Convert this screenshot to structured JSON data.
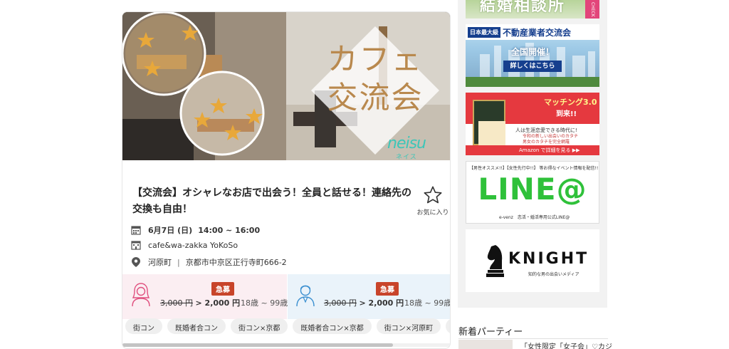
{
  "event": {
    "hero_title": "カフェ交流会",
    "logo_text": "neisu",
    "logo_sub": "ネイス",
    "title": "【交流会】オシャレなお店で出会う！全員と話せる！連絡先の交換も自由！",
    "favorite_label": "お気に入り",
    "date": "6月7日 (日)",
    "time": "14:00 ~ 16:00",
    "venue": "cafe&wa-zakka YoKoSo",
    "area": "河原町",
    "address": "京都市中京区正行寺町666-2",
    "female": {
      "badge": "急募",
      "old_price": "3,000 円",
      "new_price": "> 2,000 円",
      "age": "18歳 ~ 99歳"
    },
    "male": {
      "badge": "急募",
      "old_price": "3,000 円",
      "new_price": "> 2,000 円",
      "age": "18歳 ~ 99歳"
    },
    "tags": [
      "街コン",
      "既婚者合コン",
      "街コン×京都",
      "既婚者合コン×京都",
      "街コン×河原町",
      "既"
    ]
  },
  "sidebar": {
    "banners": {
      "b1": {
        "title": "結婚相談所",
        "check": "CHECK"
      },
      "b2": {
        "tag": "日本最大級",
        "title": "不動産業者交流会",
        "sub": "全国開催！",
        "button": "詳しくはこちら"
      },
      "b3": {
        "head": "マッチング3.0",
        "head2": "到来!!",
        "line1": "人は生涯恋愛できる時代に!",
        "line2": "令和の新しい出会いのカタチ",
        "line3": "男女のカタチを完全網羅",
        "amazon": "Amazon で詳細を見る ▶▶"
      },
      "b4": {
        "top": "【男性オススメ!!】【女性先行中!!】 等お得なイベント情報を配信!!",
        "logo": "LINE@",
        "bottom": "e-venz　恋活・婚活専用公式LINE@"
      },
      "b5": {
        "logo": "KNIGHT",
        "sub": "知的な男の出会いメディア"
      }
    },
    "section_title": "新着パーティー",
    "news_title": "「女性限定「女子会」♡カジ"
  },
  "colors": {
    "badge": "#c8442a",
    "line_green": "#2fc13a",
    "female_bg": "#fbeef2",
    "male_bg": "#eaf3fa",
    "hero_title": "#b9894e"
  }
}
